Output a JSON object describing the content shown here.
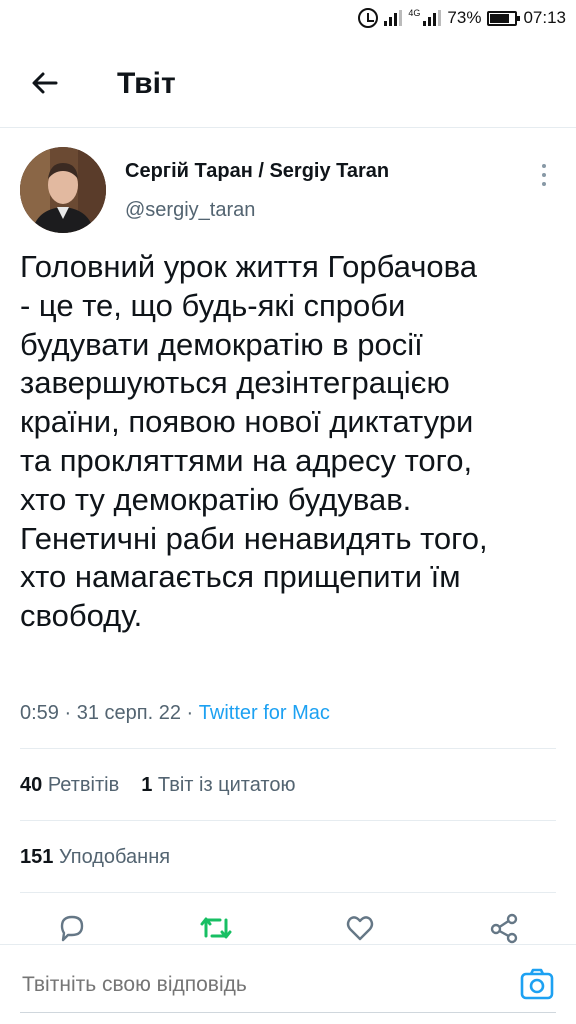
{
  "statusbar": {
    "network": "4G",
    "battery": "73%",
    "time": "07:13"
  },
  "header": {
    "title": "Твіт"
  },
  "tweet": {
    "author_name": "Сергій Таран / Sergiy Taran",
    "author_handle": "@sergiy_taran",
    "text_lines": [
      "Головний урок життя Горбачова",
      "- це те, що будь-які спроби",
      "будувати демократію в росії",
      "завершуються дезінтеграцією",
      "країни, появою нової диктатури",
      "та прокляттями на адресу того,",
      "хто ту демократію будував.",
      "Генетичні раби ненавидять того,",
      "хто намагається прищепити їм",
      "свободу."
    ],
    "time": "0:59",
    "date": "31 серп. 22",
    "source": "Twitter for Mac",
    "separator": "·"
  },
  "stats": {
    "retweets_count": "40",
    "retweets_label": "Ретвітів",
    "quotes_count": "1",
    "quotes_label": "Твіт із цитатою",
    "likes_count": "151",
    "likes_label": "Уподобання"
  },
  "reply": {
    "placeholder": "Твітніть свою відповідь"
  },
  "colors": {
    "accent": "#1da1f2",
    "retweet_green": "#17bf63",
    "secondary_text": "#536471"
  },
  "icons": [
    "alarm-icon",
    "signal-icon",
    "battery-icon",
    "back-arrow-icon",
    "more-vertical-icon",
    "reply-icon",
    "retweet-icon",
    "like-icon",
    "share-icon",
    "camera-icon"
  ]
}
